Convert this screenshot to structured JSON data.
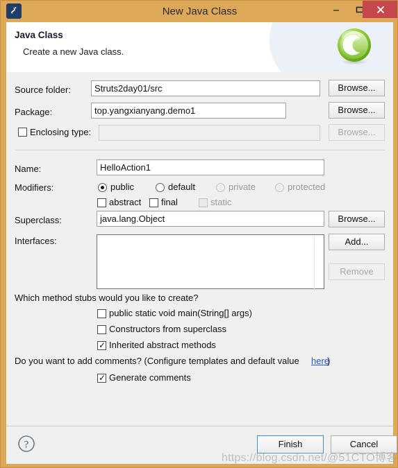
{
  "window": {
    "title": "New Java Class",
    "app_icon": "java-icon",
    "controls": {
      "minimize": "minimize-icon",
      "maximize": "maximize-icon",
      "close": "close-icon"
    },
    "titlebar_color": "#dda858",
    "close_color": "#c6474c"
  },
  "header": {
    "title": "Java Class",
    "description": "Create a new Java class.",
    "icon": "green-class-icon"
  },
  "form": {
    "source_folder": {
      "label": "Source folder:",
      "value": "Struts2day01/src",
      "browse_label": "Browse..."
    },
    "package": {
      "label": "Package:",
      "value": "top.yangxianyang.demo1",
      "browse_label": "Browse..."
    },
    "enclosing_type": {
      "label": "Enclosing type:",
      "checked": false,
      "value": "",
      "browse_label": "Browse...",
      "enabled": false
    },
    "name": {
      "label": "Name:",
      "value": "HelloAction1"
    },
    "modifiers": {
      "label": "Modifiers:",
      "radios": [
        {
          "label": "public",
          "selected": true,
          "enabled": true
        },
        {
          "label": "default",
          "selected": false,
          "enabled": true
        },
        {
          "label": "private",
          "selected": false,
          "enabled": false
        },
        {
          "label": "protected",
          "selected": false,
          "enabled": false
        }
      ],
      "checkboxes": [
        {
          "label": "abstract",
          "checked": false,
          "enabled": true
        },
        {
          "label": "final",
          "checked": false,
          "enabled": true
        },
        {
          "label": "static",
          "checked": false,
          "enabled": false
        }
      ]
    },
    "superclass": {
      "label": "Superclass:",
      "value": "java.lang.Object",
      "browse_label": "Browse..."
    },
    "interfaces": {
      "label": "Interfaces:",
      "items": [],
      "add_label": "Add...",
      "remove_label": "Remove",
      "remove_enabled": false
    }
  },
  "stubs": {
    "question": "Which method stubs would you like to create?",
    "options": [
      {
        "label": "public static void main(String[] args)",
        "checked": false
      },
      {
        "label": "Constructors from superclass",
        "checked": false
      },
      {
        "label": "Inherited abstract methods",
        "checked": true
      }
    ]
  },
  "comments": {
    "prompt_before": "Do you want to add comments? (Configure templates and default value ",
    "link_text": "here",
    "prompt_after": ")",
    "option": {
      "label": "Generate comments",
      "checked": true
    },
    "highlight_color": "#e8392c"
  },
  "footer": {
    "help_icon": "help-icon",
    "finish_label": "Finish",
    "cancel_label": "Cancel"
  },
  "watermark": {
    "text": "https://blog.csdn.net/@51CTO博客"
  }
}
